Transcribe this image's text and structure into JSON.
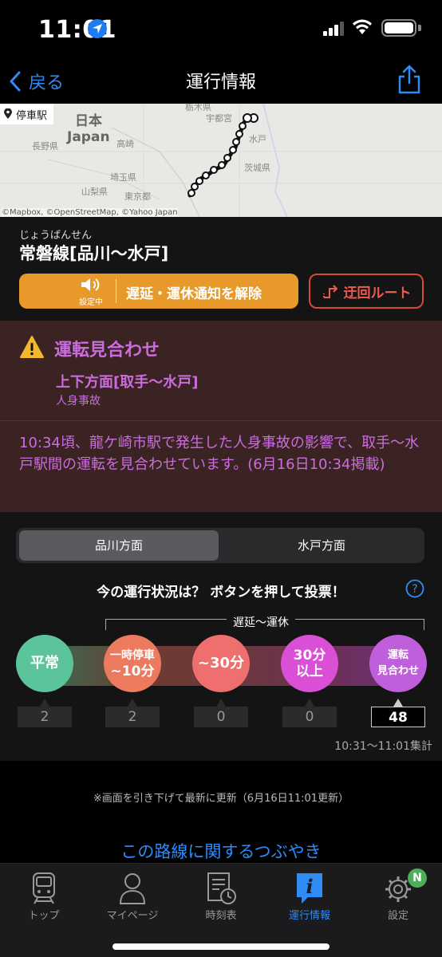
{
  "status_bar": {
    "time": "11:01"
  },
  "nav": {
    "back_label": "戻る",
    "title": "運行情報"
  },
  "map": {
    "station_chip": "停車駅",
    "labels": {
      "nihon": "日本",
      "japan": "Japan",
      "nagano": "長野県",
      "yamanashi": "山梨県",
      "saitama": "埼玉県",
      "tokyo": "東京都",
      "ibaraki": "茨城県",
      "mito": "水戸",
      "takasaki": "高崎",
      "utsunomiya": "宇都宮",
      "tochigi": "栃木県"
    },
    "credit": "©Mapbox, ©OpenStreetMap, ©Yahoo Japan"
  },
  "line": {
    "reading": "じょうばんせん",
    "name": "常磐線[品川〜水戸]",
    "notify_setting_label": "設定中",
    "notify_button": "遅延・運休通知を解除",
    "detour_button": "迂回ルート"
  },
  "alert": {
    "status": "運転見合わせ",
    "direction": "上下方面[取手〜水戸]",
    "cause": "人身事故",
    "detail": "10:34頃、龍ケ崎市駅で発生した人身事故の影響で、取手〜水戸駅間の運転を見合わせています。(6月16日10:34掲載)"
  },
  "vote": {
    "segments": [
      "品川方面",
      "水戸方面"
    ],
    "selected_segment": "品川方面",
    "question": "今の運行状況は？ ボタンを押して投票！",
    "range_label": "遅延〜運休",
    "buttons": [
      {
        "line1": "平常",
        "line2": "",
        "color": "#5cc49a"
      },
      {
        "line1": "一時停車",
        "line2": "~10分",
        "color": "#ec7a5f"
      },
      {
        "line1": "~30分",
        "line2": "",
        "color": "#ef6f6e"
      },
      {
        "line1": "30分",
        "line2": "以上",
        "color": "#d94fd6"
      },
      {
        "line1": "運転",
        "line2": "見合わせ",
        "color": "#c05fdb"
      }
    ],
    "counts": [
      "2",
      "2",
      "0",
      "0",
      "48"
    ],
    "tally_time": "10:31〜11:01集計"
  },
  "info": {
    "update_note": "※画面を引き下げて最新に更新（6月16日11:01更新）",
    "tweets_link": "この路線に関するつぶやき"
  },
  "tabs": [
    {
      "label": "トップ",
      "icon": "train-icon"
    },
    {
      "label": "マイページ",
      "icon": "person-icon"
    },
    {
      "label": "時刻表",
      "icon": "timetable-icon"
    },
    {
      "label": "運行情報",
      "icon": "info-icon"
    },
    {
      "label": "設定",
      "icon": "gear-icon",
      "badge": "N"
    }
  ],
  "active_tab": "運行情報",
  "colors": {
    "accent": "#2f8bf5",
    "notify": "#e7992a",
    "detour": "#d9473c",
    "alert_text": "#c96ddc",
    "alert_bg": "#3b2323"
  }
}
